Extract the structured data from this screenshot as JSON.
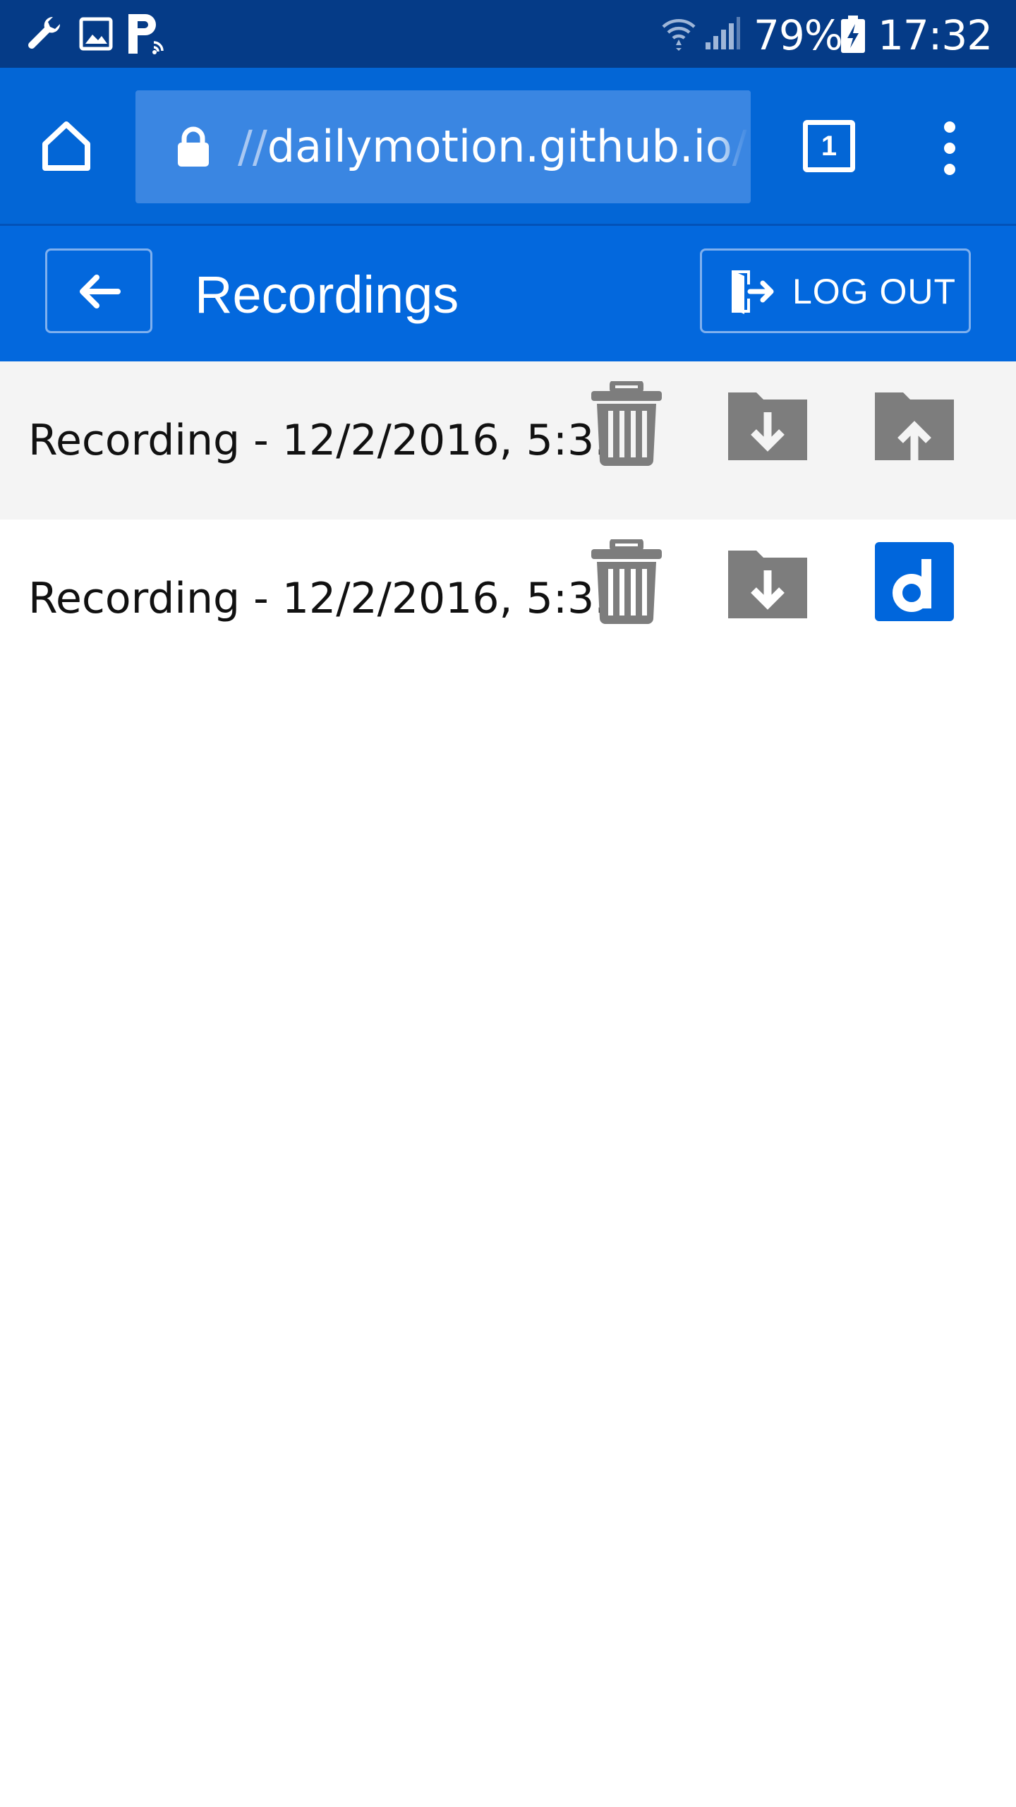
{
  "status_bar": {
    "battery": "79%",
    "time": "17:32"
  },
  "browser": {
    "url_prefix": "//",
    "url_host": "dailymotion.github.io",
    "url_suffix": "/c",
    "tab_count": "1"
  },
  "header": {
    "title": "Recordings",
    "logout_label": "LOG OUT"
  },
  "recordings": [
    {
      "name": "Recording - 12/2/2016, 5:3...",
      "third_action_icon": "folder-upload-icon"
    },
    {
      "name": "Recording - 12/2/2016, 5:3...",
      "third_action_icon": "dailymotion-icon"
    }
  ],
  "colors": {
    "status_bar": "#053b87",
    "browser_bar": "#0366d6",
    "url_box": "#3a86e2",
    "header": "#0368dd",
    "icon_gray": "#7d7d7d",
    "dailymotion_blue": "#0066dc"
  }
}
